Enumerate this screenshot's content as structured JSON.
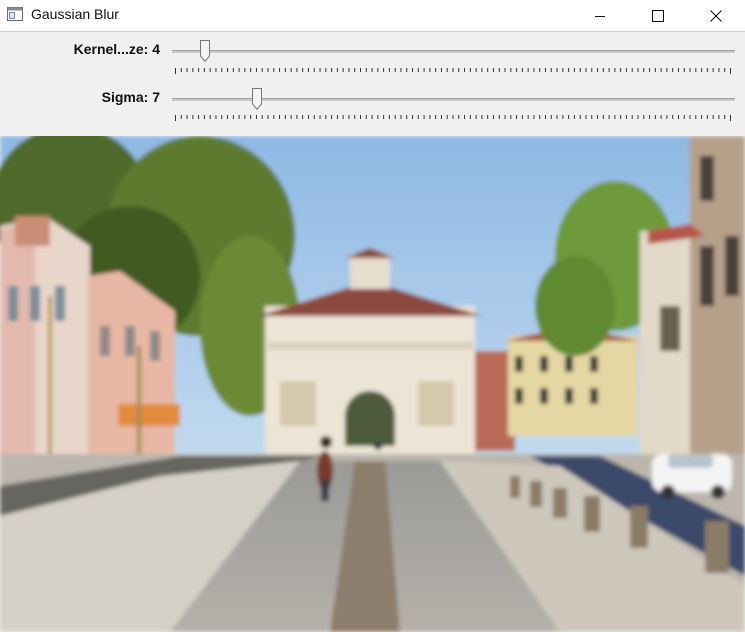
{
  "window": {
    "title": "Gaussian Blur",
    "controls": {
      "minimize_icon": "minimize-icon",
      "maximize_icon": "maximize-icon",
      "close_icon": "close-icon"
    }
  },
  "trackbars": [
    {
      "label": "Kernel...ze",
      "value": "4",
      "fraction": 0.05
    },
    {
      "label": "Sigma",
      "value": "7",
      "fraction": 0.145
    }
  ],
  "image": {
    "description_hidden": false,
    "subject": "blurred photo"
  },
  "colors": {
    "titlebar_bg": "#ffffff",
    "panel_bg": "#f0f0f0",
    "close_hover": "#e81123",
    "sky": "#a9c9e8"
  }
}
